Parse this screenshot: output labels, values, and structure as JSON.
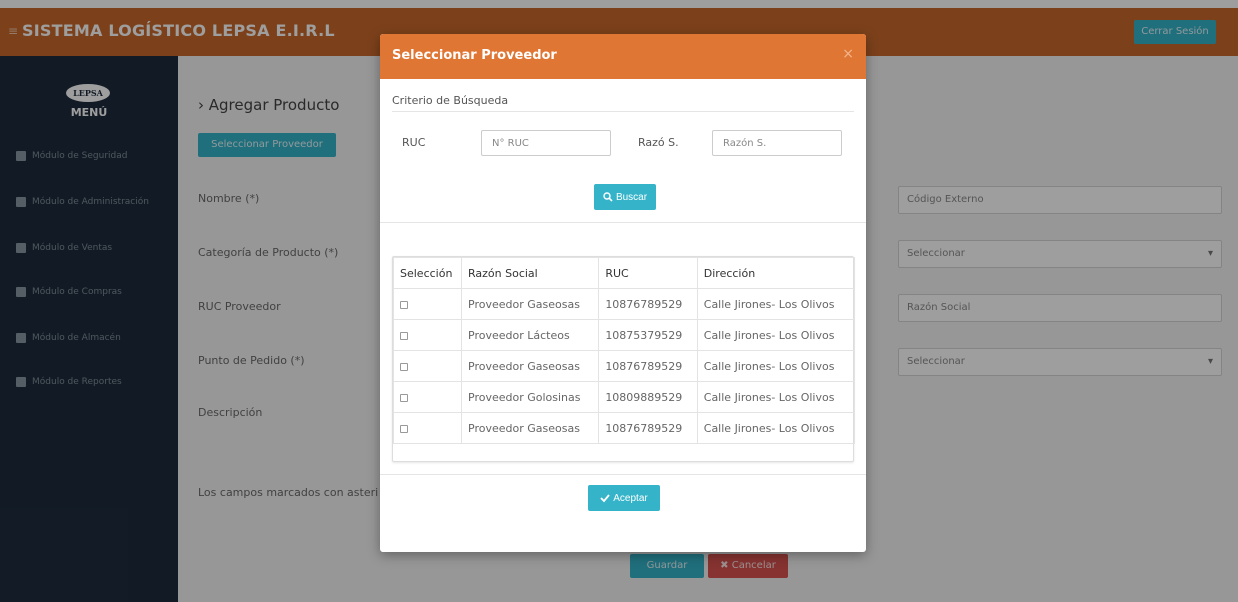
{
  "app": {
    "title": "SISTEMA LOGÍSTICO LEPSA E.I.R.L",
    "logout_label": "Cerrar Sesión",
    "menu_toggle": "≡"
  },
  "sidebar": {
    "logo_text": "LEPSA",
    "menu_title": "MENÚ",
    "items": [
      {
        "label": "Módulo de Seguridad",
        "icon": "lock-icon"
      },
      {
        "label": "Módulo de Administración",
        "icon": "gears-icon"
      },
      {
        "label": "Módulo de Ventas",
        "icon": "cart-icon"
      },
      {
        "label": "Módulo de Compras",
        "icon": "monitor-icon"
      },
      {
        "label": "Módulo de Almacén",
        "icon": "truck-icon"
      },
      {
        "label": "Módulo de Reportes",
        "icon": "file-icon"
      }
    ]
  },
  "form": {
    "title": "› Agregar Producto",
    "select_provider_label": "Seleccionar Proveedor",
    "fields": [
      {
        "label": "Nombre (*)",
        "right_value": "Código Externo"
      },
      {
        "label": "Categoría de Producto (*)",
        "right_value": "Seleccionar"
      },
      {
        "label": "RUC Proveedor",
        "right_value": "Razón Social"
      },
      {
        "label": "Punto de Pedido (*)",
        "right_value": "Seleccionar"
      },
      {
        "label": "Descripción"
      }
    ],
    "footnote": "Los campos marcados con asteri",
    "save_label": "Guardar",
    "cancel_label": "✖ Cancelar"
  },
  "modal": {
    "title": "Seleccionar Proveedor",
    "close_glyph": "×",
    "criteria_label": "Criterio de Búsqueda",
    "ruc_label": "RUC",
    "ruc_placeholder": "N° RUC",
    "razon_label": "Razó S.",
    "razon_placeholder": "Razón S.",
    "search_label": "Buscar",
    "accept_label": "Aceptar",
    "table": {
      "headers": [
        "Selección",
        "Razón Social",
        "RUC",
        "Dirección"
      ],
      "rows": [
        {
          "name": "Proveedor Gaseosas",
          "ruc": "10876789529",
          "address": "Calle Jirones- Los Olivos"
        },
        {
          "name": "Proveedor Lácteos",
          "ruc": "10875379529",
          "address": "Calle Jirones- Los Olivos"
        },
        {
          "name": "Proveedor Gaseosas",
          "ruc": "10876789529",
          "address": "Calle Jirones- Los Olivos"
        },
        {
          "name": "Proveedor Golosinas",
          "ruc": "10809889529",
          "address": "Calle Jirones- Los Olivos"
        },
        {
          "name": "Proveedor Gaseosas",
          "ruc": "10876789529",
          "address": "Calle Jirones- Los Olivos"
        }
      ]
    }
  },
  "colors": {
    "header_orange": "#c96a2c",
    "modal_header": "#e07634",
    "sidebar": "#1e2d3d",
    "accent_teal": "#35b4c9",
    "danger": "#d9534f"
  }
}
